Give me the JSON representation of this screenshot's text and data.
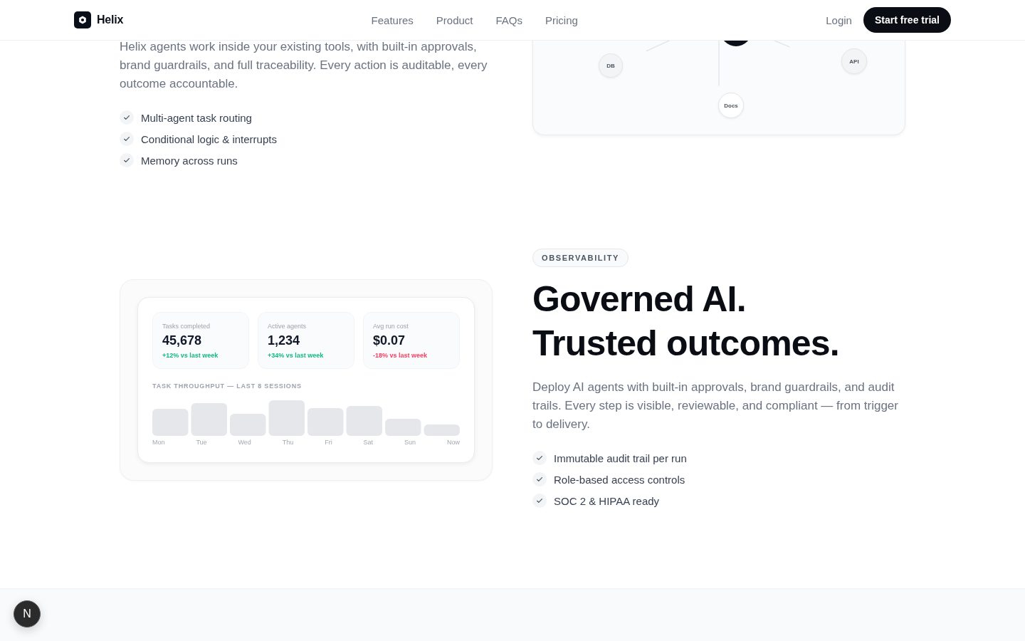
{
  "header": {
    "brand": "Helix",
    "nav": [
      {
        "label": "Features"
      },
      {
        "label": "Product"
      },
      {
        "label": "FAQs"
      },
      {
        "label": "Pricing"
      }
    ],
    "login": "Login",
    "cta": "Start free trial"
  },
  "integrations": {
    "description": "Helix agents work inside your existing tools, with built-in approvals, brand guardrails, and full traceability. Every action is auditable, every outcome accountable.",
    "features": [
      "Multi-agent task routing",
      "Conditional logic & interrupts",
      "Memory across runs"
    ],
    "diagram": {
      "nodes": [
        {
          "label": "DB"
        },
        {
          "label": "API"
        },
        {
          "label": "Docs"
        }
      ]
    }
  },
  "observability": {
    "badge": "OBSERVABILITY",
    "heading": [
      "Governed AI.",
      "Trusted outcomes."
    ],
    "description": "Deploy AI agents with built-in approvals, brand guardrails, and audit trails. Every step is visible, reviewable, and compliant — from trigger to delivery.",
    "features": [
      "Immutable audit trail per run",
      "Role-based access controls",
      "SOC 2 & HIPAA ready"
    ],
    "dashboard": {
      "stats": [
        {
          "label": "Tasks completed",
          "value": "45,678",
          "change": "+12% vs last week",
          "color": "#10b981"
        },
        {
          "label": "Active agents",
          "value": "1,234",
          "change": "+34% vs last week",
          "color": "#10b981"
        },
        {
          "label": "Avg run cost",
          "value": "$0.07",
          "change": "-18% vs last week",
          "color": "#f43f5e"
        }
      ],
      "chart_title": "TASK THROUGHPUT — LAST 8 SESSIONS",
      "chart_labels": [
        "Mon",
        "Tue",
        "Wed",
        "Thu",
        "Fri",
        "Sat",
        "Sun",
        "Now"
      ]
    }
  },
  "dev_badge": {
    "label": "N"
  }
}
